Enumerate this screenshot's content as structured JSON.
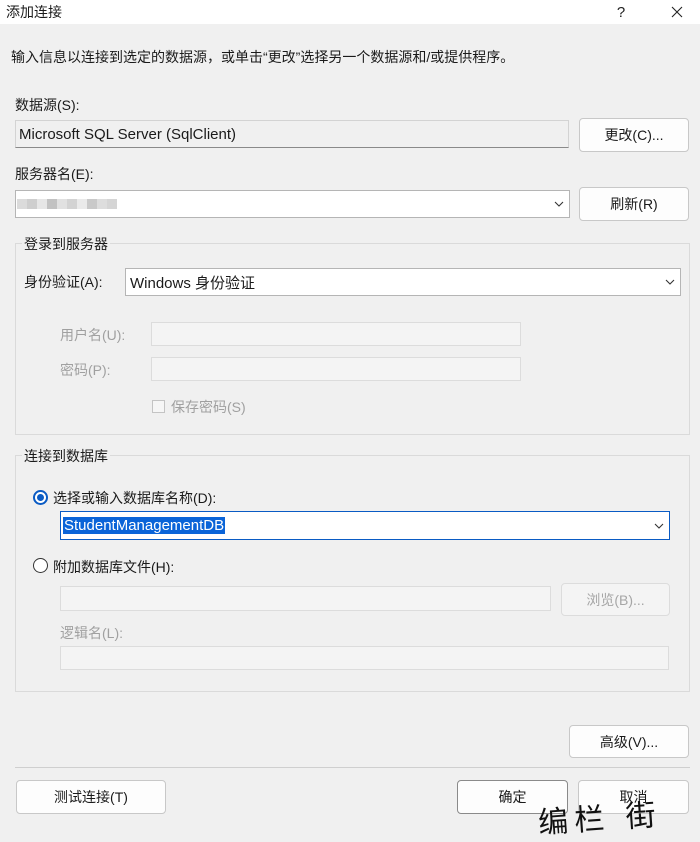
{
  "window": {
    "title": "添加连接",
    "help_label": "?",
    "close_label": "╳"
  },
  "intro": "输入信息以连接到选定的数据源，或单击“更改”选择另一个数据源和/或提供程序。",
  "data_source": {
    "label": "数据源(S):",
    "value": "Microsoft SQL Server (SqlClient)",
    "change_button": "更改(C)..."
  },
  "server": {
    "label": "服务器名(E):",
    "value": "",
    "refresh_button": "刷新(R)"
  },
  "login_group": {
    "title": "登录到服务器",
    "auth_label": "身份验证(A):",
    "auth_value": "Windows 身份验证",
    "username_label": "用户名(U):",
    "username_value": "",
    "password_label": "密码(P):",
    "password_value": "",
    "save_password_label": "保存密码(S)",
    "save_password_checked": false
  },
  "db_group": {
    "title": "连接到数据库",
    "select_option_label": "选择或输入数据库名称(D):",
    "select_option_selected": true,
    "database_value": "StudentManagementDB",
    "attach_option_label": "附加数据库文件(H):",
    "attach_option_selected": false,
    "attach_file_value": "",
    "browse_button": "浏览(B)...",
    "logical_name_label": "逻辑名(L):",
    "logical_name_value": ""
  },
  "advanced_button": "高级(V)...",
  "footer": {
    "test_button": "测试连接(T)",
    "ok_button": "确定",
    "cancel_button": "取消"
  },
  "watermark": "编栏 街",
  "colors": {
    "accent": "#0a5bc4",
    "selection": "#0a64d8",
    "background": "#f0f0f0"
  }
}
